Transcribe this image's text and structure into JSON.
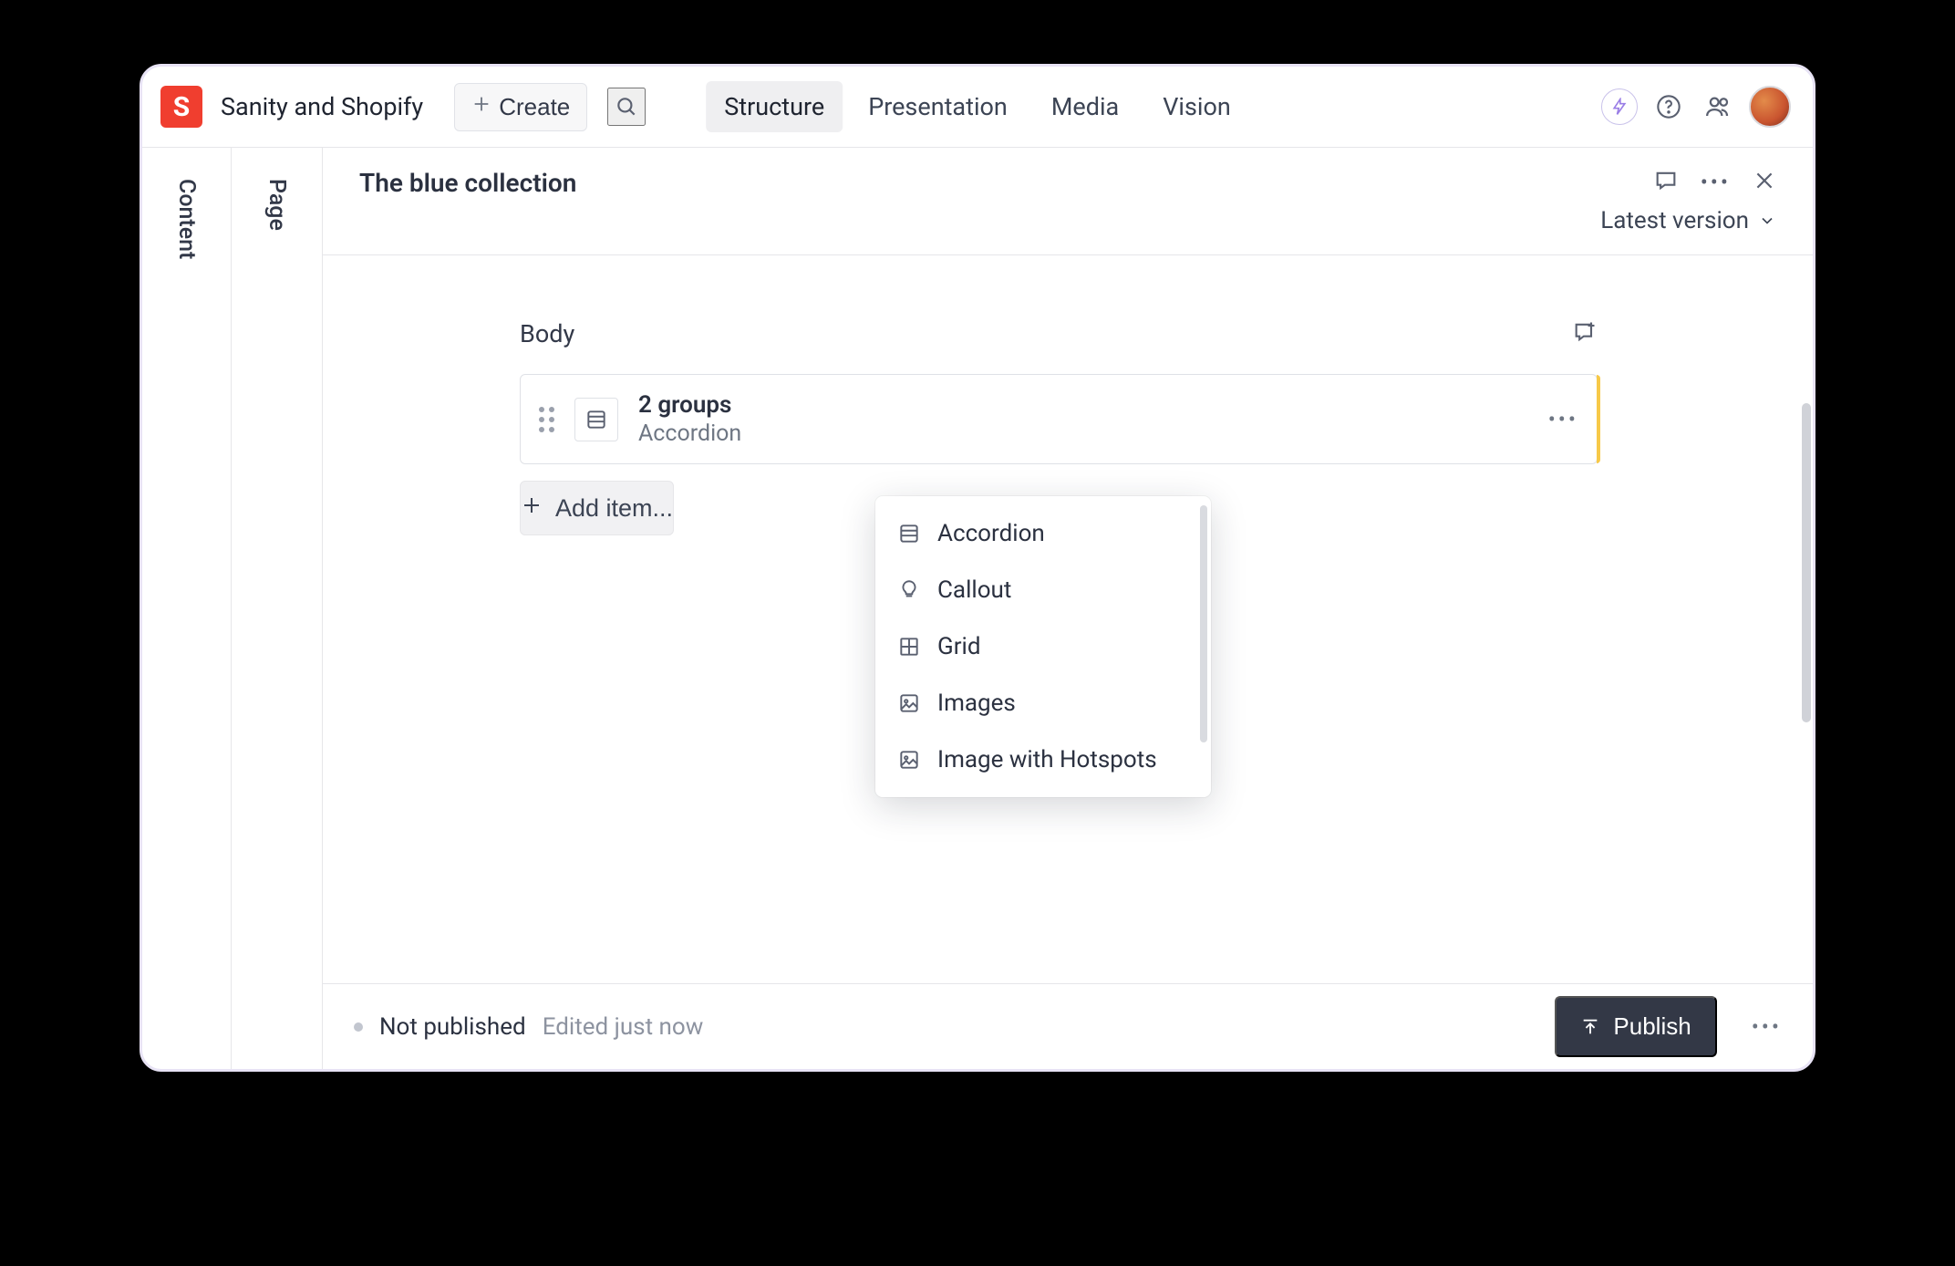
{
  "header": {
    "workspace_name": "Sanity and Shopify",
    "create_label": "Create",
    "nav": [
      {
        "label": "Structure",
        "active": true
      },
      {
        "label": "Presentation",
        "active": false
      },
      {
        "label": "Media",
        "active": false
      },
      {
        "label": "Vision",
        "active": false
      }
    ]
  },
  "rails": [
    {
      "label": "Content"
    },
    {
      "label": "Page"
    }
  ],
  "document": {
    "title": "The blue collection",
    "version_label": "Latest version"
  },
  "field": {
    "label": "Body",
    "items": [
      {
        "title": "2 groups",
        "subtitle": "Accordion"
      }
    ],
    "add_label": "Add item..."
  },
  "menu": {
    "options": [
      {
        "label": "Accordion",
        "icon": "list-rows"
      },
      {
        "label": "Callout",
        "icon": "lightbulb"
      },
      {
        "label": "Grid",
        "icon": "grid-2x2"
      },
      {
        "label": "Images",
        "icon": "image"
      },
      {
        "label": "Image with Hotspots",
        "icon": "image"
      }
    ]
  },
  "footer": {
    "status": "Not published",
    "edited": "Edited just now",
    "publish_label": "Publish"
  }
}
